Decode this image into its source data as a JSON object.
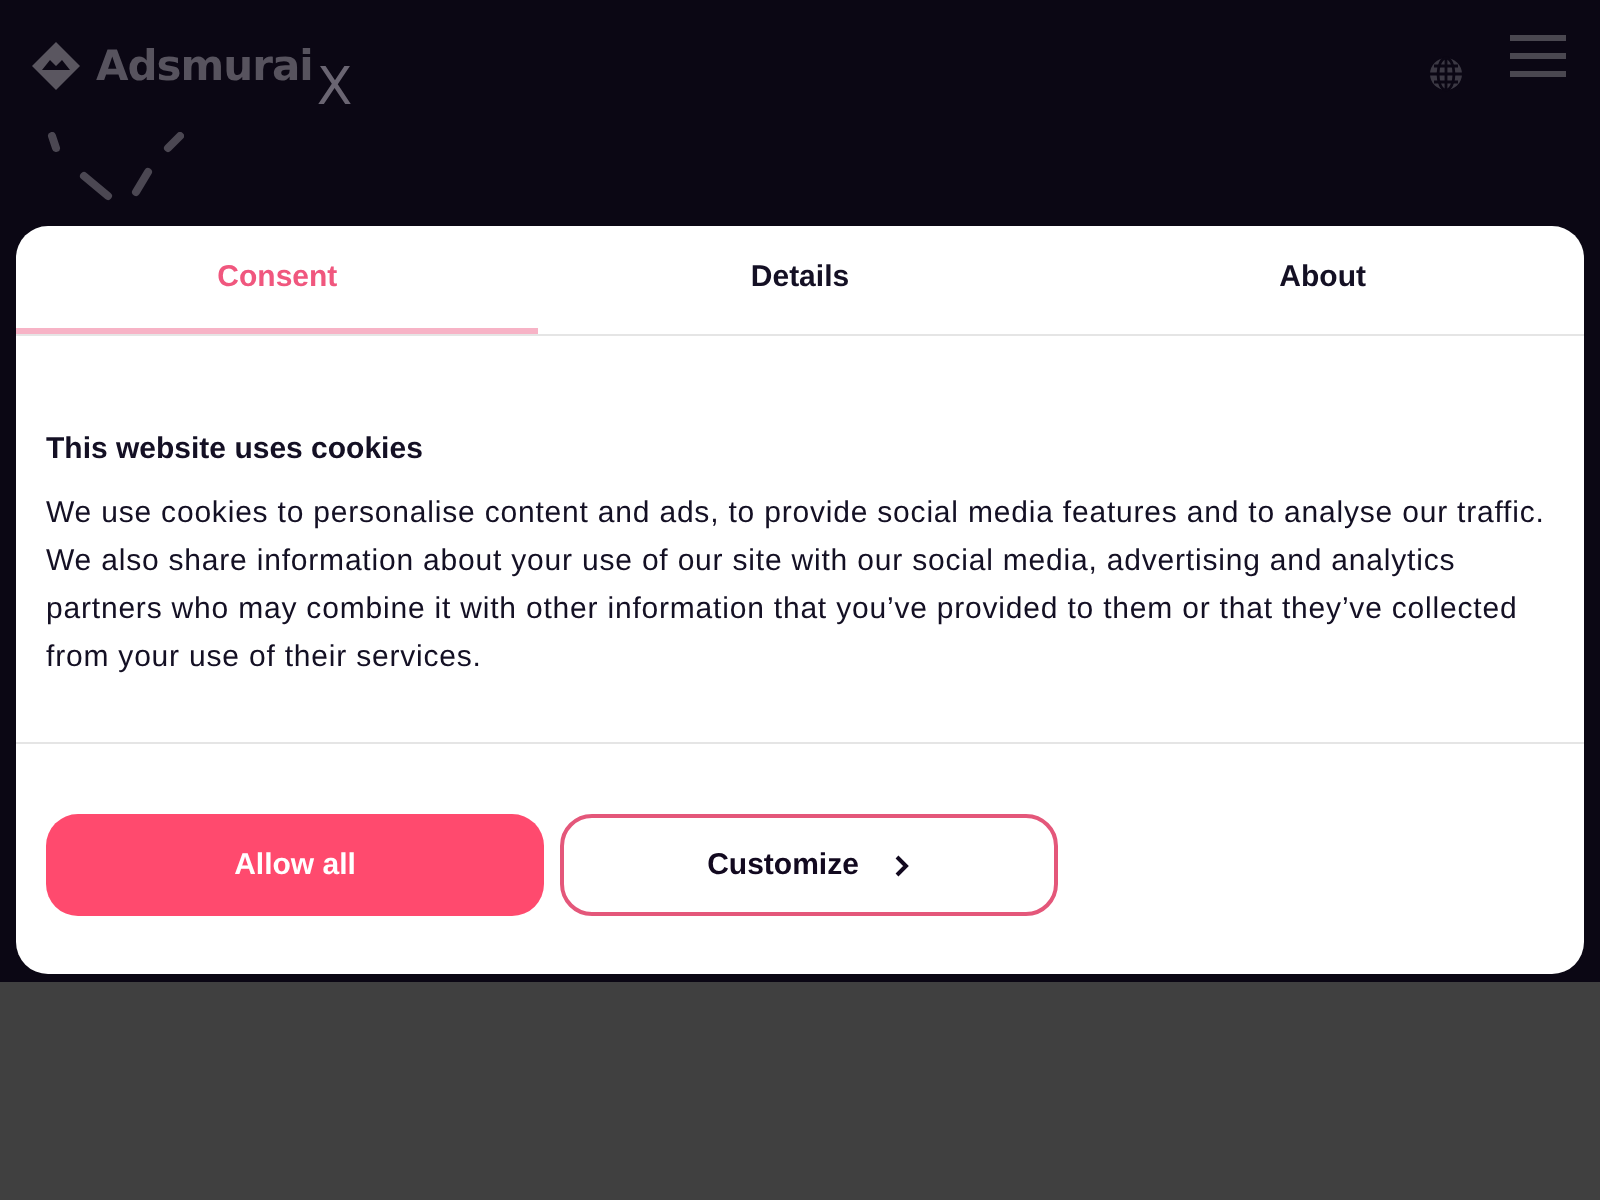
{
  "header": {
    "logo": "Adsmurai",
    "close_mark": "X"
  },
  "dialog": {
    "tabs": [
      {
        "label": "Consent",
        "selected": true
      },
      {
        "label": "Details",
        "selected": false
      },
      {
        "label": "About",
        "selected": false
      }
    ],
    "title": "This website uses cookies",
    "body": "We use cookies to personalise content and ads, to provide social media features and to analyse our traffic. We also share information about your use of our site with our social media, advertising and analytics partners who may combine it with other information that you’ve provided to them or that they’ve collected from your use of their services.",
    "buttons": [
      {
        "label": "Allow all",
        "kind": "primary"
      },
      {
        "label": "Customize",
        "kind": "secondary"
      }
    ]
  }
}
